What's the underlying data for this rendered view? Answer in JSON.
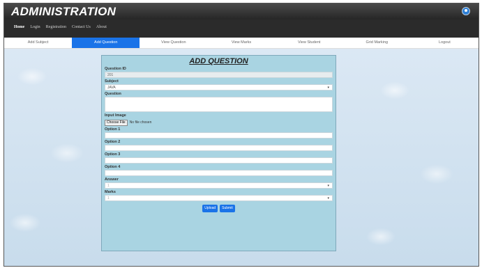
{
  "app": {
    "title": "ADMINISTRATION"
  },
  "navbar": {
    "items": [
      "Home",
      "Login",
      "Registration",
      "Contact Us",
      "About"
    ]
  },
  "tabs": [
    "Add Subject",
    "Add Question",
    "View Question",
    "View Marks",
    "View Student",
    "Grid Marking",
    "Logout"
  ],
  "active_tab": "Add Question",
  "form": {
    "heading": "ADD QUESTION",
    "question_id_label": "Question ID",
    "question_id_value": "201",
    "subject_label": "Subject",
    "subject_value": "JAVA",
    "question_label": "Question",
    "question_value": "",
    "input_image_label": "Input Image",
    "choose_file_label": "Choose File",
    "no_file_text": "No file chosen",
    "option1_label": "Option 1",
    "option2_label": "Option 2",
    "option3_label": "Option 3",
    "option4_label": "Option 4",
    "answer_label": "Answer",
    "answer_value": "1",
    "marks_label": "Marks",
    "marks_value": "1",
    "upload_label": "Upload",
    "submit_label": "Submit"
  },
  "colors": {
    "accent": "#1a73e8",
    "form_bg": "#a9d4e2",
    "topbar": "#2b2b2b"
  },
  "icons": {
    "user": "user-circle-icon"
  }
}
